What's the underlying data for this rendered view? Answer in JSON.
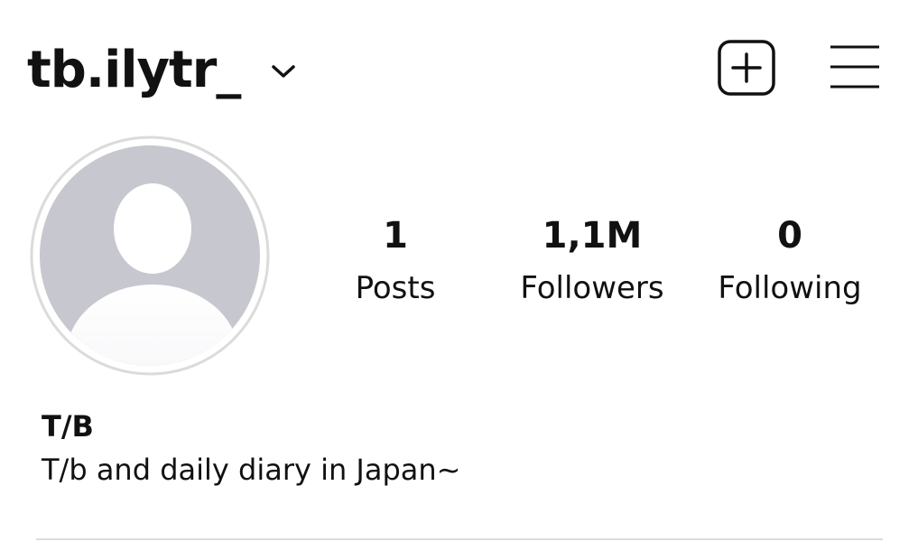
{
  "header": {
    "username": "tb.ilytr_",
    "chevron_icon": "chevron-down-icon",
    "new_post_icon": "add-square-icon",
    "menu_icon": "hamburger-menu-icon"
  },
  "profile": {
    "avatar_icon": "default-avatar-icon",
    "stats": {
      "posts": {
        "count": "1",
        "label": "Posts"
      },
      "followers": {
        "count": "1,1M",
        "label": "Followers"
      },
      "following": {
        "count": "0",
        "label": "Following"
      }
    },
    "display_name": "T/B",
    "bio": "T/b and daily diary in Japan~"
  },
  "colors": {
    "text": "#111111",
    "avatar_background": "#c7c7cf",
    "avatar_ring": "#dbdbdb",
    "divider": "#dbdbdb"
  }
}
